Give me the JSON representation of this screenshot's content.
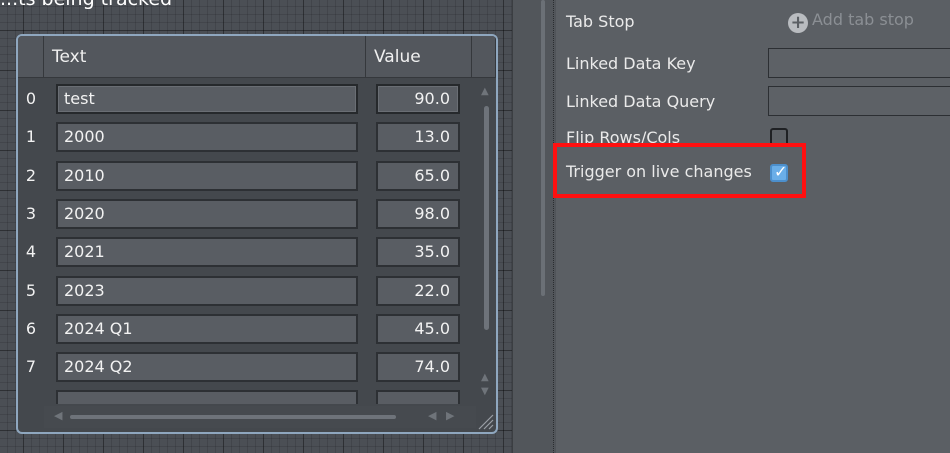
{
  "canvas": {
    "caption": "...ts being tracked"
  },
  "table": {
    "columns": [
      "Text",
      "Value"
    ],
    "rows": [
      {
        "index": "0",
        "text": "test",
        "value": "90.0"
      },
      {
        "index": "1",
        "text": "2000",
        "value": "13.0"
      },
      {
        "index": "2",
        "text": "2010",
        "value": "65.0"
      },
      {
        "index": "3",
        "text": "2020",
        "value": "98.0"
      },
      {
        "index": "4",
        "text": "2021",
        "value": "35.0"
      },
      {
        "index": "5",
        "text": "2023",
        "value": "22.0"
      },
      {
        "index": "6",
        "text": "2024 Q1",
        "value": "45.0"
      },
      {
        "index": "7",
        "text": "2024 Q2",
        "value": "74.0"
      }
    ]
  },
  "properties": {
    "tab_stop": {
      "label": "Tab Stop",
      "action": "Add tab stop"
    },
    "linked_data_key": {
      "label": "Linked Data Key",
      "value": ""
    },
    "linked_data_query": {
      "label": "Linked Data Query",
      "value": ""
    },
    "flip_rows_cols": {
      "label": "Flip Rows/Cols",
      "checked": false
    },
    "trigger_on_live_changes": {
      "label": "Trigger on live changes",
      "checked": true
    }
  },
  "colors": {
    "highlight": "#ff1010",
    "checkbox_checked": "#6aaee8"
  }
}
